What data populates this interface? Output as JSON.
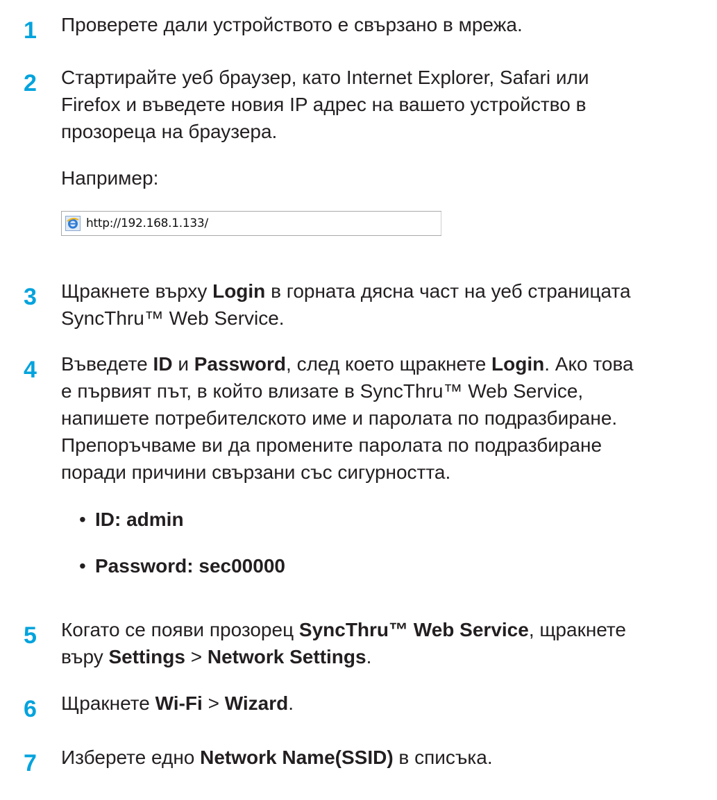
{
  "steps": [
    {
      "num": "1",
      "lines": [
        "Проверете дали устройството е свързано в мрежа."
      ]
    },
    {
      "num": "2",
      "lines": [
        "Стартирайте уеб браузер, като Internet Explorer, Safari или",
        "Firefox и въведете новия IP адрес на вашето устройство в",
        "прозореца на браузера."
      ],
      "example_label": "Например:",
      "example_url": "http://192.168.1.133/"
    },
    {
      "num": "3",
      "line1_pre": "Щракнете върху ",
      "line1_bold": "Login",
      "line1_post": " в горната дясна част на уеб страницата",
      "line2": "SyncThru™ Web Service."
    },
    {
      "num": "4",
      "l1_a": "Въведете ",
      "l1_b": "ID",
      "l1_c": " и ",
      "l1_d": "Password",
      "l1_e": ", след което щракнете ",
      "l1_f": "Login",
      "l1_g": ". Ако това",
      "lines_rest": [
        "е първият път, в който влизате в SyncThru™ Web Service,",
        "напишете потребителското име и паролата по подразбиране.",
        "Препоръчваме ви да промените паролата по подразбиране",
        "поради причини свързани със сигурността."
      ],
      "bullets": [
        "ID: admin",
        "Password: sec00000"
      ]
    },
    {
      "num": "5",
      "l1_a": "Когато се появи прозорец ",
      "l1_b": "SyncThru™ Web Service",
      "l1_c": ", щракнете",
      "l2_a": "вър",
      "l2_a2": "у ",
      "l2_b": "Settings",
      "l2_c": " > ",
      "l2_d": "Network Settings",
      "l2_e": "."
    },
    {
      "num": "6",
      "a": "Щракнете ",
      "b": "Wi-Fi",
      "c": " > ",
      "d": "Wizard",
      "e": "."
    },
    {
      "num": "7",
      "a": "Изберете едно ",
      "b": "Network Name(SSID)",
      "c": " в списъка."
    }
  ],
  "bullet_symbol": "•",
  "colors": {
    "step_number": "#00a3dd",
    "text": "#231f20"
  },
  "icons": {
    "browser": "internet-explorer-icon"
  }
}
